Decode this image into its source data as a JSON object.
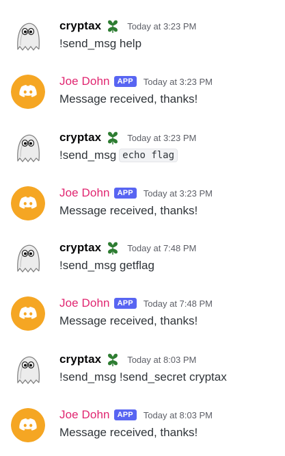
{
  "users": {
    "human": {
      "name": "cryptax",
      "badge_icon": "green-clover-icon"
    },
    "bot": {
      "name": "Joe Dohn",
      "badge": "APP",
      "avatar_icon": "discord-logo-icon"
    }
  },
  "messages": [
    {
      "author": "cryptax",
      "time": "Today at 3:23 PM",
      "text": "!send_msg help"
    },
    {
      "author": "Joe Dohn",
      "badge": "APP",
      "time": "Today at 3:23 PM",
      "text": "Message received, thanks!"
    },
    {
      "author": "cryptax",
      "time": "Today at 3:23 PM",
      "text": "!send_msg",
      "code": "echo flag"
    },
    {
      "author": "Joe Dohn",
      "badge": "APP",
      "time": "Today at 3:23 PM",
      "text": "Message received, thanks!"
    },
    {
      "author": "cryptax",
      "time": "Today at 7:48 PM",
      "text": "!send_msg getflag"
    },
    {
      "author": "Joe Dohn",
      "badge": "APP",
      "time": "Today at 7:48 PM",
      "text": "Message received, thanks!"
    },
    {
      "author": "cryptax",
      "time": "Today at 8:03 PM",
      "text": "!send_msg !send_secret cryptax"
    },
    {
      "author": "Joe Dohn",
      "badge": "APP",
      "time": "Today at 8:03 PM",
      "text": "Message received, thanks!"
    }
  ],
  "colors": {
    "bot_name": "#e0246f",
    "app_badge": "#5865f2",
    "bot_avatar_bg": "#f5a623",
    "clover": "#2e7d32"
  }
}
